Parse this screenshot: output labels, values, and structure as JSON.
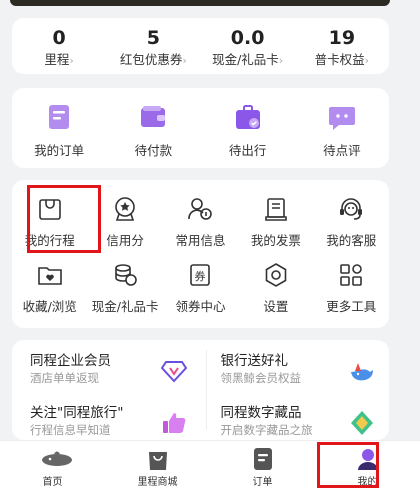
{
  "stats": [
    {
      "value": "0",
      "label": "里程"
    },
    {
      "value": "5",
      "label": "红包优惠券"
    },
    {
      "value": "0.0",
      "label": "现金/礼品卡"
    },
    {
      "value": "19",
      "label": "普卡权益"
    }
  ],
  "orders": [
    {
      "label": "我的订单",
      "icon": "order-list-icon"
    },
    {
      "label": "待付款",
      "icon": "wallet-icon"
    },
    {
      "label": "待出行",
      "icon": "suitcase-icon"
    },
    {
      "label": "待点评",
      "icon": "chat-bubble-icon"
    }
  ],
  "tools": [
    {
      "label": "我的行程",
      "icon": "itinerary-bag-icon"
    },
    {
      "label": "信用分",
      "icon": "credit-badge-icon"
    },
    {
      "label": "常用信息",
      "icon": "contact-info-icon"
    },
    {
      "label": "我的发票",
      "icon": "invoice-icon"
    },
    {
      "label": "我的客服",
      "icon": "headset-icon"
    },
    {
      "label": "收藏/浏览",
      "icon": "favorite-folder-icon"
    },
    {
      "label": "现金/礼品卡",
      "icon": "coins-icon"
    },
    {
      "label": "领券中心",
      "icon": "coupon-icon"
    },
    {
      "label": "设置",
      "icon": "settings-hex-icon"
    },
    {
      "label": "更多工具",
      "icon": "grid-icon"
    }
  ],
  "promos": [
    {
      "title": "同程企业会员",
      "subtitle": "酒店单单返现",
      "icon": "diamond-badge-icon"
    },
    {
      "title": "银行送好礼",
      "subtitle": "领黑鲸会员权益",
      "icon": "whale-icon"
    },
    {
      "title": "关注\"同程旅行\"",
      "subtitle": "行程信息早知道",
      "icon": "thumbs-up-icon"
    },
    {
      "title": "同程数字藏品",
      "subtitle": "开启数字藏品之旅",
      "icon": "digital-collectible-icon"
    }
  ],
  "tabs": [
    {
      "label": "首页",
      "icon": "whale-home-icon"
    },
    {
      "label": "里程商城",
      "icon": "shopping-bag-icon"
    },
    {
      "label": "订单",
      "icon": "order-tab-icon"
    },
    {
      "label": "我的",
      "icon": "profile-icon"
    }
  ],
  "colors": {
    "accent": "#8b57e8",
    "highlight": "#e0161a",
    "background": "#f1f2f4"
  }
}
